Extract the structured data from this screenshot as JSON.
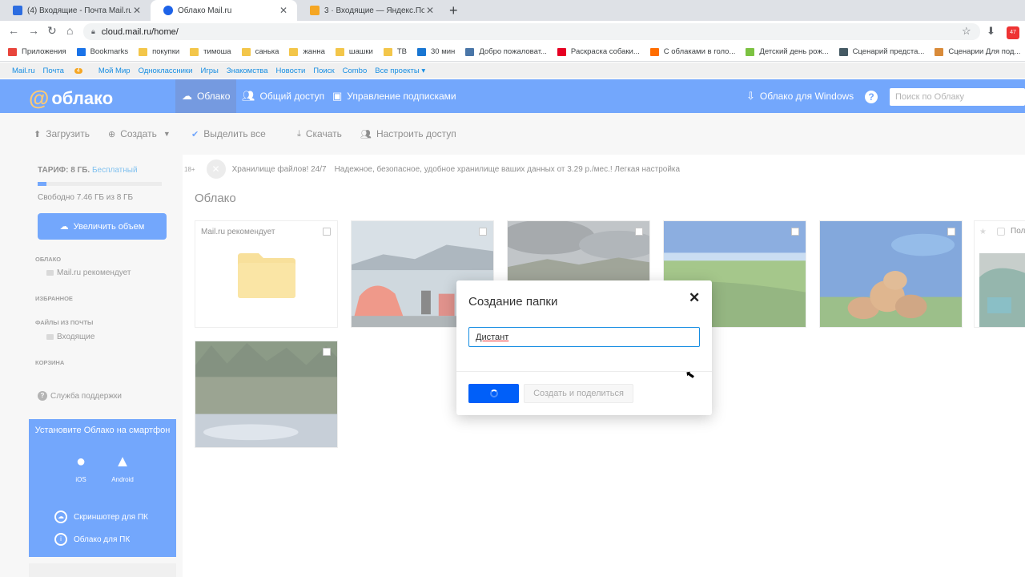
{
  "browser": {
    "tabs": [
      {
        "title": "(4) Входящие - Почта Mail.ru",
        "close": "✕",
        "fav": "#2d6de0"
      },
      {
        "title": "Облако Mail.ru",
        "close": "✕",
        "fav": "#1e63e8"
      },
      {
        "title": "3 · Входящие — Яндекс.Почта",
        "close": "✕",
        "fav": "#f5a623"
      }
    ],
    "new_tab": "+",
    "url": "cloud.mail.ru/home/",
    "nav": {
      "back": "←",
      "forward": "→",
      "reload": "↻",
      "home": "⌂",
      "star": "☆",
      "download": "⬇"
    },
    "ext_badge": "47",
    "bookmarks": [
      {
        "label": "Приложения",
        "color": "#e8453c"
      },
      {
        "label": "Bookmarks",
        "color": "#1a73e8"
      },
      {
        "label": "покупки",
        "color": "#f3c64a"
      },
      {
        "label": "тимоша",
        "color": "#f3c64a"
      },
      {
        "label": "санька",
        "color": "#f3c64a"
      },
      {
        "label": "жанна",
        "color": "#f3c64a"
      },
      {
        "label": "шашки",
        "color": "#f3c64a"
      },
      {
        "label": "ТВ",
        "color": "#f3c64a"
      },
      {
        "label": "30 мин",
        "color": "#1976d2"
      },
      {
        "label": "Добро пожаловат...",
        "color": "#4a76a8"
      },
      {
        "label": "Раскраска собаки...",
        "color": "#e60023"
      },
      {
        "label": "С облаками в голо...",
        "color": "#ff6d00"
      },
      {
        "label": "Детский день рож...",
        "color": "#7cc242"
      },
      {
        "label": "Сценарий предста...",
        "color": "#455a64"
      },
      {
        "label": "Сценарии Для под...",
        "color": "#d98b3a"
      }
    ]
  },
  "portal": {
    "links": [
      "Mail.ru",
      "Почта",
      "Мой Мир",
      "Одноклассники",
      "Игры",
      "Знакомства",
      "Новости",
      "Поиск",
      "Combo",
      "Все проекты ▾"
    ],
    "mail_badge": "4"
  },
  "header": {
    "logo_at": "@",
    "logo_text": "облако",
    "nav": [
      "Облако",
      "Общий доступ",
      "Управление подписками"
    ],
    "windows": "Облако для Windows",
    "help": "?",
    "search_placeholder": "Поиск по Облаку"
  },
  "actions": [
    "Загрузить",
    "Создать",
    "Выделить все",
    "Скачать",
    "Настроить доступ"
  ],
  "sidebar": {
    "tariff_label": "ТАРИФ: 8 ГБ.",
    "tariff_free": "Бесплатный",
    "used_fraction": 0.07,
    "free_text": "Свободно 7.46 ГБ из 8 ГБ",
    "increase": "Увеличить объем",
    "sections": {
      "cloud": "ОБЛАКО",
      "cloud_item": "Mail.ru рекомендует",
      "favorites": "ИЗБРАННОЕ",
      "mail_files": "ФАЙЛЫ ИЗ ПОЧТЫ",
      "mail_item": "Входящие",
      "trash": "КОРЗИНА"
    },
    "support": "Служба поддержки",
    "promo": {
      "title": "Установите Облако на смартфон",
      "ios": "iOS",
      "android": "Android",
      "screenshot": "Скриншотер для ПК",
      "desktop": "Облако для ПК"
    }
  },
  "main": {
    "ad": {
      "age": "18+",
      "title": "Хранилище файлов! 24/7",
      "text": "Надежное, безопасное, удобное хранилище ваших данных от 3.29 р./мес.! Легкая настройка"
    },
    "breadcrumb": "Облако",
    "folder_name": "Mail.ru рекомендует",
    "partial_card_label": "Пол"
  },
  "modal": {
    "title": "Создание папки",
    "close": "✕",
    "input_value": "Дистант",
    "share_button": "Создать и поделиться"
  }
}
